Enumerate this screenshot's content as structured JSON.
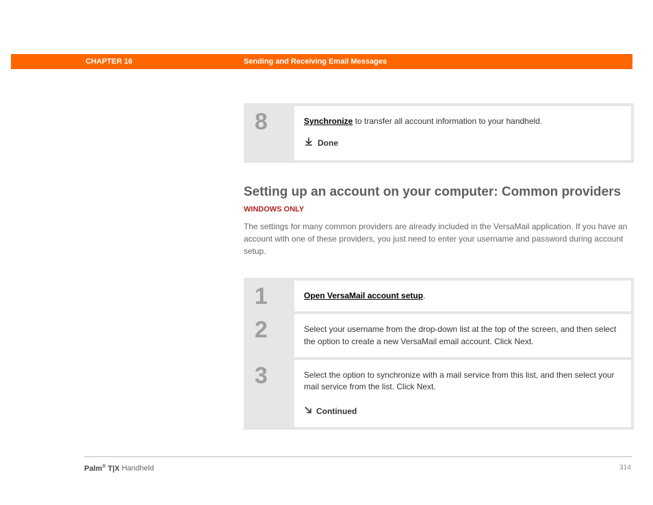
{
  "header": {
    "chapter": "CHAPTER 16",
    "title": "Sending and Receiving Email Messages"
  },
  "top_step": {
    "number": "8",
    "link_text": "Synchronize",
    "after_link": " to transfer all account information to your handheld.",
    "done_label": "Done"
  },
  "section": {
    "heading": "Setting up an account on your computer: Common providers",
    "sublabel": "WINDOWS ONLY",
    "paragraph": "The settings for many common providers are already included in the VersaMail application. If you have an account with one of these providers, you just need to enter your username and password during account setup."
  },
  "steps": [
    {
      "number": "1",
      "link_text": "Open VersaMail account setup",
      "after_link": "."
    },
    {
      "number": "2",
      "text": "Select your username from the drop-down list at the top of the screen, and then select the option to create a new VersaMail email account. Click Next."
    },
    {
      "number": "3",
      "text": "Select the option to synchronize with a mail service from this list, and then select your mail service from the list. Click Next.",
      "continued_label": "Continued"
    }
  ],
  "footer": {
    "brand_strong": "Palm",
    "reg": "®",
    "brand_rest": " T|X",
    "tail": " Handheld",
    "page": "314"
  }
}
